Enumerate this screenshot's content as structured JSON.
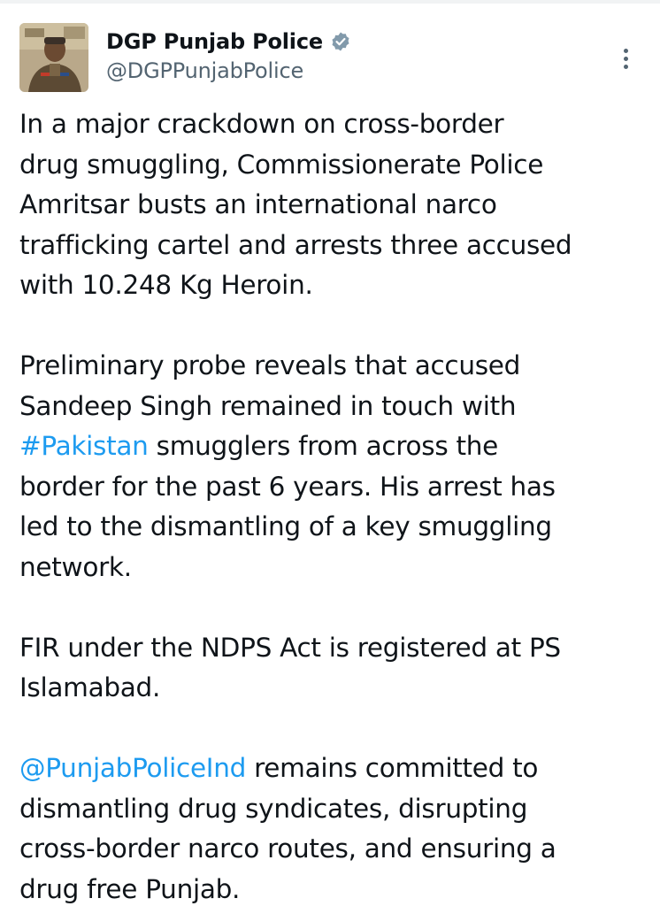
{
  "tweet": {
    "author": {
      "display_name": "DGP Punjab Police",
      "handle": "@DGPPunjabPolice",
      "verified": true
    },
    "paragraphs": [
      {
        "lines": [
          "In a major crackdown on cross-border",
          "drug smuggling, Commissionerate Police",
          "Amritsar busts an international narco",
          "trafficking cartel and arrests three accused",
          "with 10.248 Kg Heroin."
        ]
      },
      {
        "lines_before": [
          "Preliminary probe reveals that accused",
          "Sandeep Singh remained in touch with"
        ],
        "hashtag": "#Pakistan",
        "hashtag_rest": " smugglers from across the",
        "lines_after": [
          "border for the past 6 years. His arrest has",
          "led to the dismantling of a key smuggling",
          "network."
        ]
      },
      {
        "lines": [
          "FIR under the NDPS Act is registered at PS",
          "Islamabad."
        ]
      },
      {
        "mention": "@PunjabPoliceInd",
        "mention_rest": " remains committed to",
        "lines_after": [
          "dismantling drug syndicates, disrupting",
          "cross-border narco routes, and ensuring a",
          "drug free Punjab."
        ]
      }
    ]
  },
  "colors": {
    "text": "#0f1419",
    "secondary": "#536471",
    "link": "#1d9bf0",
    "verified_badge": "#829aab"
  },
  "icons": {
    "verified": "verified-badge-icon",
    "more": "more-vertical-icon"
  }
}
